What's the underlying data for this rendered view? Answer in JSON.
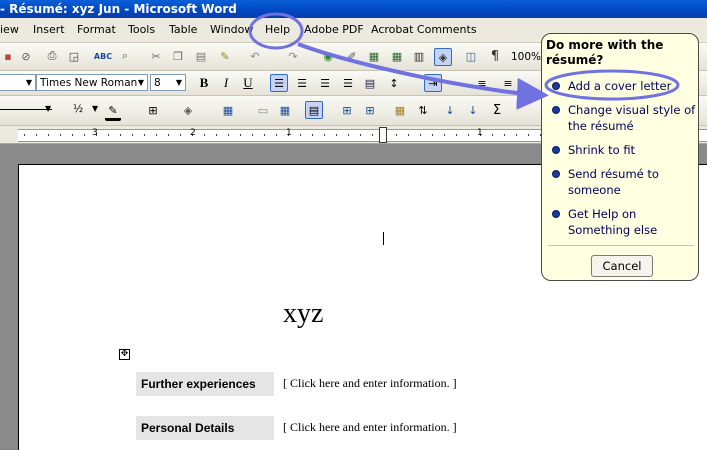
{
  "titlebar": {
    "title": "- Résumé: xyz Jun - Microsoft Word"
  },
  "menubar": {
    "items": [
      "iew",
      "Insert",
      "Format",
      "Tools",
      "Table",
      "Window",
      "Help",
      "Adobe PDF",
      "Acrobat Comments"
    ]
  },
  "formatting": {
    "font_name": "Times New Roman",
    "font_size": "8",
    "zoom": "100%",
    "fraction": "½"
  },
  "document": {
    "heading": "xyz",
    "rows": [
      {
        "label": "Further experiences",
        "value": "[  Click here and enter information.  ]"
      },
      {
        "label": "Personal Details",
        "value": "[  Click here and enter information.  ]"
      }
    ]
  },
  "assistant": {
    "title": "Do more with the résumé?",
    "options": [
      "Add a cover letter",
      "Change visual style of the résumé",
      "Shrink to fit",
      "Send résumé to someone",
      "Get Help on Something else"
    ],
    "cancel": "Cancel"
  },
  "colors": {
    "highlight_oval": "#6f72e0",
    "titlebar": "#0046c0",
    "balloon_bg": "#ffffe1"
  },
  "ruler": {
    "labels": [
      "3",
      "2",
      "1",
      "1"
    ]
  }
}
